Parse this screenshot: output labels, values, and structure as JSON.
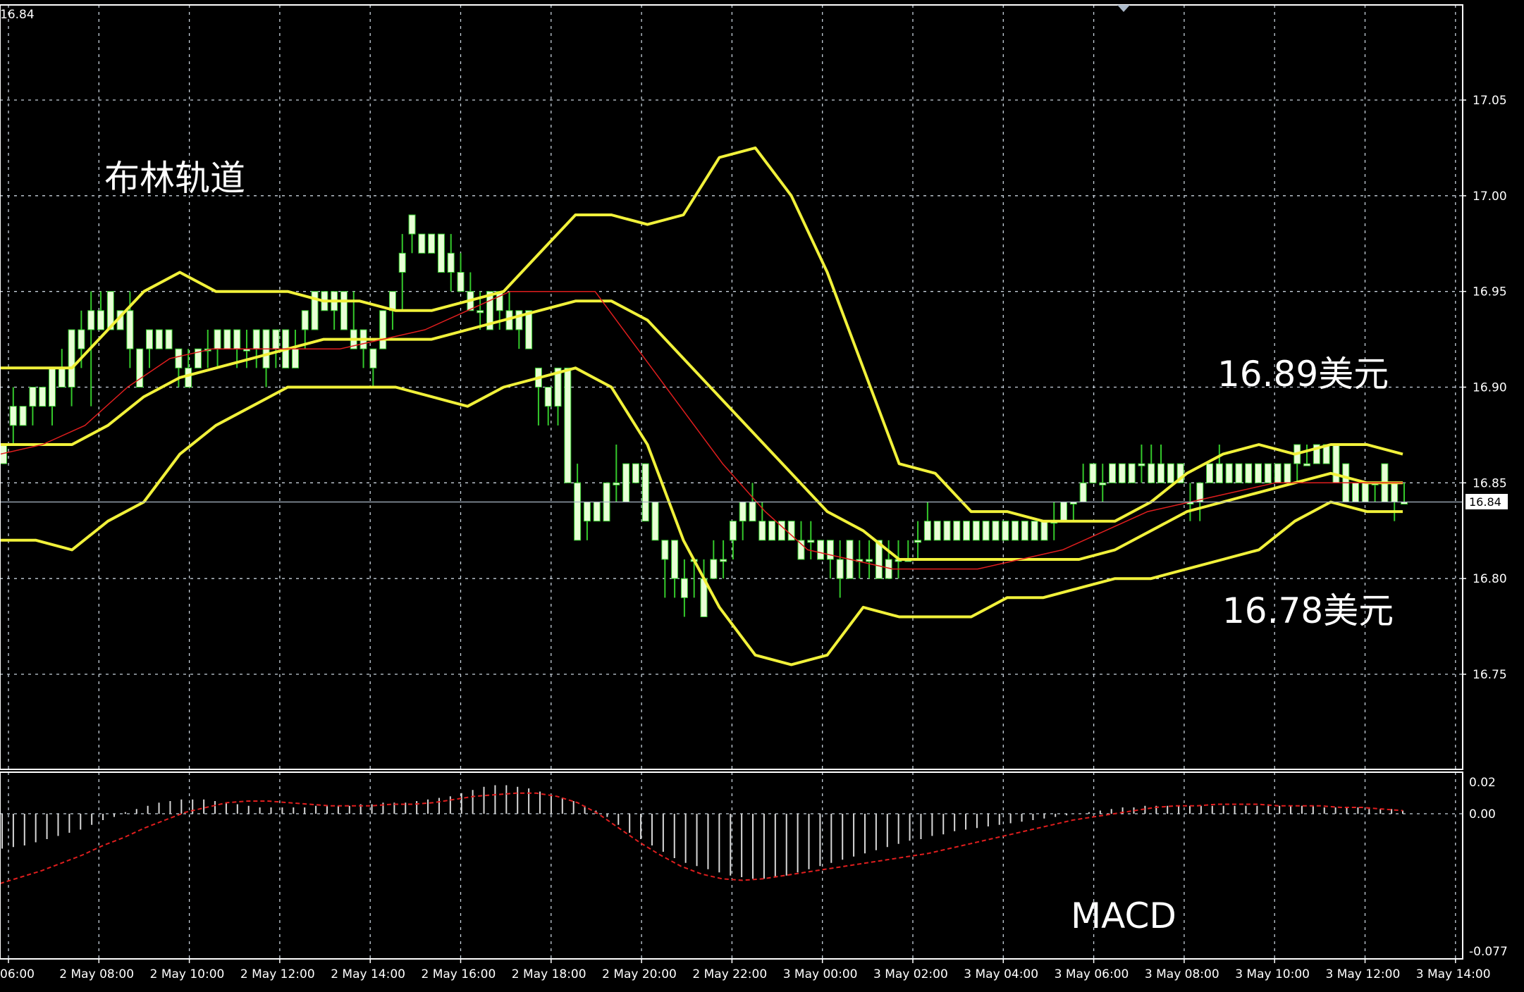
{
  "top_left_price": "16.84",
  "annotations": {
    "bollinger_title": "布林轨道",
    "upper_price": "16.89美元",
    "lower_price": "16.78美元",
    "macd_title": "MACD"
  },
  "current_price": {
    "label": "16.84",
    "value": 16.84
  },
  "colors": {
    "background": "#000000",
    "grid": "#c8d2dc",
    "bull_candle_fill": "#e8ffd6",
    "bull_candle_wick": "#34c92b",
    "bollinger": "#f1f13a",
    "moving_average": "#e01e1e",
    "macd_histogram": "#d8d8d8",
    "macd_signal": "#e01e1e",
    "axis_text": "#ffffff"
  },
  "chart_data": [
    {
      "type": "candlestick",
      "title": "布林轨道",
      "y_ticks": [
        "17.05",
        "17.00",
        "16.95",
        "16.90",
        "16.85",
        "16.80",
        "16.75"
      ],
      "ylim": [
        16.705,
        17.085
      ],
      "x_ticks": [
        "2 May 06:00",
        "2 May 08:00",
        "2 May 10:00",
        "2 May 12:00",
        "2 May 14:00",
        "2 May 16:00",
        "2 May 18:00",
        "2 May 20:00",
        "2 May 22:00",
        "3 May 00:00",
        "3 May 02:00",
        "3 May 04:00",
        "3 May 06:00",
        "3 May 08:00",
        "3 May 10:00",
        "3 May 12:00",
        "3 May 14:00"
      ],
      "grid": true,
      "candles_ohlc": [
        [
          16.86,
          16.87,
          16.86,
          16.87
        ],
        [
          16.89,
          16.9,
          16.87,
          16.88
        ],
        [
          16.88,
          16.89,
          16.88,
          16.89
        ],
        [
          16.89,
          16.9,
          16.88,
          16.9
        ],
        [
          16.9,
          16.9,
          16.89,
          16.89
        ],
        [
          16.89,
          16.91,
          16.88,
          16.91
        ],
        [
          16.91,
          16.92,
          16.9,
          16.9
        ],
        [
          16.9,
          16.93,
          16.89,
          16.93
        ],
        [
          16.93,
          16.94,
          16.91,
          16.92
        ],
        [
          16.93,
          16.95,
          16.89,
          16.94
        ],
        [
          16.93,
          16.95,
          16.93,
          16.94
        ],
        [
          16.95,
          16.95,
          16.94,
          16.93
        ],
        [
          16.94,
          16.94,
          16.93,
          16.93
        ],
        [
          16.94,
          16.95,
          16.91,
          16.92
        ],
        [
          16.92,
          16.92,
          16.9,
          16.9
        ],
        [
          16.93,
          16.93,
          16.91,
          16.92
        ],
        [
          16.92,
          16.93,
          16.92,
          16.93
        ],
        [
          16.92,
          16.93,
          16.92,
          16.93
        ],
        [
          16.92,
          16.92,
          16.9,
          16.91
        ],
        [
          16.91,
          16.92,
          16.9,
          16.9
        ],
        [
          16.91,
          16.92,
          16.91,
          16.92
        ],
        [
          16.92,
          16.93,
          16.91,
          16.92
        ],
        [
          16.92,
          16.93,
          16.91,
          16.93
        ],
        [
          16.93,
          16.93,
          16.92,
          16.92
        ],
        [
          16.92,
          16.93,
          16.91,
          16.93
        ],
        [
          16.92,
          16.93,
          16.91,
          16.92
        ],
        [
          16.92,
          16.93,
          16.91,
          16.93
        ],
        [
          16.91,
          16.93,
          16.9,
          16.93
        ],
        [
          16.93,
          16.93,
          16.91,
          16.92
        ],
        [
          16.93,
          16.93,
          16.91,
          16.91
        ],
        [
          16.92,
          16.93,
          16.91,
          16.91
        ],
        [
          16.93,
          16.94,
          16.92,
          16.94
        ],
        [
          16.93,
          16.95,
          16.93,
          16.95
        ],
        [
          16.95,
          16.95,
          16.94,
          16.94
        ],
        [
          16.95,
          16.95,
          16.93,
          16.94
        ],
        [
          16.95,
          16.95,
          16.93,
          16.93
        ],
        [
          16.93,
          16.95,
          16.92,
          16.92
        ],
        [
          16.93,
          16.93,
          16.91,
          16.92
        ],
        [
          16.92,
          16.92,
          16.9,
          16.91
        ],
        [
          16.92,
          16.94,
          16.92,
          16.94
        ],
        [
          16.94,
          16.95,
          16.93,
          16.95
        ],
        [
          16.96,
          16.98,
          16.94,
          16.97
        ],
        [
          16.99,
          16.99,
          16.97,
          16.98
        ],
        [
          16.98,
          16.98,
          16.97,
          16.97
        ],
        [
          16.98,
          16.98,
          16.97,
          16.97
        ],
        [
          16.98,
          16.98,
          16.96,
          16.96
        ],
        [
          16.96,
          16.98,
          16.95,
          16.97
        ],
        [
          16.96,
          16.97,
          16.95,
          16.95
        ],
        [
          16.95,
          16.96,
          16.94,
          16.94
        ],
        [
          16.94,
          16.95,
          16.93,
          16.94
        ],
        [
          16.95,
          16.95,
          16.93,
          16.93
        ],
        [
          16.95,
          16.95,
          16.93,
          16.94
        ],
        [
          16.94,
          16.95,
          16.93,
          16.93
        ],
        [
          16.94,
          16.94,
          16.92,
          16.93
        ],
        [
          16.94,
          16.94,
          16.92,
          16.92
        ],
        [
          16.91,
          16.91,
          16.88,
          16.9
        ],
        [
          16.89,
          16.9,
          16.88,
          16.9
        ],
        [
          16.89,
          16.91,
          16.88,
          16.91
        ],
        [
          16.91,
          16.91,
          16.85,
          16.85
        ],
        [
          16.85,
          16.86,
          16.82,
          16.82
        ],
        [
          16.84,
          16.84,
          16.82,
          16.83
        ],
        [
          16.83,
          16.84,
          16.83,
          16.84
        ],
        [
          16.83,
          16.85,
          16.83,
          16.85
        ],
        [
          16.85,
          16.87,
          16.84,
          16.85
        ],
        [
          16.86,
          16.86,
          16.84,
          16.84
        ],
        [
          16.86,
          16.86,
          16.85,
          16.85
        ],
        [
          16.86,
          16.86,
          16.83,
          16.83
        ],
        [
          16.84,
          16.84,
          16.82,
          16.82
        ],
        [
          16.82,
          16.82,
          16.79,
          16.81
        ],
        [
          16.82,
          16.82,
          16.79,
          16.8
        ],
        [
          16.79,
          16.81,
          16.78,
          16.8
        ],
        [
          16.81,
          16.81,
          16.79,
          16.81
        ],
        [
          16.78,
          16.81,
          16.78,
          16.8
        ],
        [
          16.8,
          16.82,
          16.8,
          16.81
        ],
        [
          16.81,
          16.82,
          16.8,
          16.81
        ],
        [
          16.82,
          16.83,
          16.81,
          16.83
        ],
        [
          16.83,
          16.84,
          16.82,
          16.84
        ],
        [
          16.84,
          16.85,
          16.83,
          16.83
        ],
        [
          16.83,
          16.84,
          16.82,
          16.82
        ],
        [
          16.83,
          16.83,
          16.82,
          16.82
        ],
        [
          16.83,
          16.83,
          16.82,
          16.82
        ],
        [
          16.82,
          16.83,
          16.82,
          16.83
        ],
        [
          16.82,
          16.83,
          16.81,
          16.81
        ],
        [
          16.82,
          16.83,
          16.81,
          16.82
        ],
        [
          16.82,
          16.82,
          16.81,
          16.81
        ],
        [
          16.82,
          16.82,
          16.8,
          16.81
        ],
        [
          16.81,
          16.82,
          16.79,
          16.8
        ],
        [
          16.82,
          16.82,
          16.8,
          16.8
        ],
        [
          16.81,
          16.82,
          16.8,
          16.81
        ],
        [
          16.81,
          16.82,
          16.8,
          16.81
        ],
        [
          16.82,
          16.82,
          16.8,
          16.8
        ],
        [
          16.81,
          16.82,
          16.8,
          16.8
        ],
        [
          16.81,
          16.82,
          16.8,
          16.81
        ],
        [
          16.81,
          16.82,
          16.81,
          16.81
        ],
        [
          16.82,
          16.83,
          16.81,
          16.82
        ],
        [
          16.83,
          16.84,
          16.82,
          16.82
        ],
        [
          16.83,
          16.83,
          16.82,
          16.82
        ],
        [
          16.83,
          16.83,
          16.82,
          16.82
        ],
        [
          16.83,
          16.83,
          16.82,
          16.82
        ],
        [
          16.83,
          16.83,
          16.82,
          16.82
        ],
        [
          16.83,
          16.83,
          16.82,
          16.82
        ],
        [
          16.83,
          16.83,
          16.82,
          16.82
        ],
        [
          16.83,
          16.83,
          16.82,
          16.82
        ],
        [
          16.83,
          16.83,
          16.82,
          16.82
        ],
        [
          16.83,
          16.83,
          16.82,
          16.82
        ],
        [
          16.83,
          16.83,
          16.82,
          16.82
        ],
        [
          16.83,
          16.83,
          16.82,
          16.82
        ],
        [
          16.83,
          16.83,
          16.82,
          16.82
        ],
        [
          16.83,
          16.84,
          16.82,
          16.83
        ],
        [
          16.83,
          16.84,
          16.83,
          16.84
        ],
        [
          16.84,
          16.84,
          16.83,
          16.84
        ],
        [
          16.84,
          16.86,
          16.84,
          16.85
        ],
        [
          16.85,
          16.86,
          16.85,
          16.86
        ],
        [
          16.85,
          16.86,
          16.84,
          16.85
        ],
        [
          16.85,
          16.86,
          16.85,
          16.86
        ],
        [
          16.85,
          16.86,
          16.85,
          16.86
        ],
        [
          16.85,
          16.86,
          16.85,
          16.86
        ],
        [
          16.86,
          16.87,
          16.85,
          16.86
        ],
        [
          16.86,
          16.87,
          16.85,
          16.85
        ],
        [
          16.86,
          16.87,
          16.85,
          16.85
        ],
        [
          16.86,
          16.86,
          16.85,
          16.85
        ],
        [
          16.85,
          16.86,
          16.85,
          16.86
        ],
        [
          16.84,
          16.85,
          16.83,
          16.84
        ],
        [
          16.84,
          16.85,
          16.83,
          16.85
        ],
        [
          16.86,
          16.86,
          16.85,
          16.85
        ],
        [
          16.86,
          16.87,
          16.85,
          16.85
        ],
        [
          16.86,
          16.86,
          16.85,
          16.85
        ],
        [
          16.86,
          16.86,
          16.85,
          16.85
        ],
        [
          16.86,
          16.86,
          16.85,
          16.85
        ],
        [
          16.86,
          16.86,
          16.85,
          16.85
        ],
        [
          16.86,
          16.86,
          16.85,
          16.85
        ],
        [
          16.86,
          16.86,
          16.85,
          16.85
        ],
        [
          16.85,
          16.86,
          16.85,
          16.86
        ],
        [
          16.86,
          16.87,
          16.85,
          16.87
        ],
        [
          16.86,
          16.87,
          16.86,
          16.86
        ],
        [
          16.87,
          16.87,
          16.86,
          16.86
        ],
        [
          16.86,
          16.87,
          16.86,
          16.87
        ],
        [
          16.87,
          16.87,
          16.85,
          16.85
        ],
        [
          16.86,
          16.86,
          16.84,
          16.84
        ],
        [
          16.85,
          16.85,
          16.84,
          16.84
        ],
        [
          16.85,
          16.85,
          16.84,
          16.84
        ],
        [
          16.85,
          16.85,
          16.84,
          16.85
        ],
        [
          16.86,
          16.86,
          16.84,
          16.84
        ],
        [
          16.85,
          16.85,
          16.83,
          16.84
        ],
        [
          16.84,
          16.85,
          16.84,
          16.84
        ]
      ],
      "bollinger_upper": [
        16.91,
        16.91,
        16.91,
        16.93,
        16.95,
        16.96,
        16.95,
        16.95,
        16.95,
        16.945,
        16.945,
        16.94,
        16.94,
        16.945,
        16.95,
        16.97,
        16.99,
        16.99,
        16.985,
        16.99,
        17.02,
        17.025,
        17.0,
        16.96,
        16.91,
        16.86,
        16.855,
        16.835,
        16.835,
        16.83,
        16.83,
        16.83,
        16.84,
        16.855,
        16.865,
        16.87,
        16.865,
        16.87,
        16.87,
        16.865
      ],
      "bollinger_middle": [
        16.87,
        16.87,
        16.87,
        16.88,
        16.895,
        16.905,
        16.91,
        16.915,
        16.92,
        16.925,
        16.925,
        16.925,
        16.925,
        16.93,
        16.935,
        16.94,
        16.945,
        16.945,
        16.935,
        16.915,
        16.895,
        16.875,
        16.855,
        16.835,
        16.825,
        16.81,
        16.81,
        16.81,
        16.81,
        16.81,
        16.81,
        16.815,
        16.825,
        16.835,
        16.84,
        16.845,
        16.85,
        16.855,
        16.85,
        16.85
      ],
      "bollinger_lower": [
        16.82,
        16.82,
        16.815,
        16.83,
        16.84,
        16.865,
        16.88,
        16.89,
        16.9,
        16.9,
        16.9,
        16.9,
        16.895,
        16.89,
        16.9,
        16.905,
        16.91,
        16.9,
        16.87,
        16.82,
        16.785,
        16.76,
        16.755,
        16.76,
        16.785,
        16.78,
        16.78,
        16.78,
        16.79,
        16.79,
        16.795,
        16.8,
        16.8,
        16.805,
        16.81,
        16.815,
        16.83,
        16.84,
        16.835,
        16.835
      ],
      "moving_average": [
        16.865,
        16.87,
        16.88,
        16.9,
        16.915,
        16.92,
        16.92,
        16.92,
        16.92,
        16.925,
        16.93,
        16.94,
        16.95,
        16.95,
        16.95,
        16.92,
        16.89,
        16.86,
        16.835,
        16.815,
        16.81,
        16.805,
        16.805,
        16.805,
        16.81,
        16.815,
        16.825,
        16.835,
        16.84,
        16.845,
        16.85,
        16.85,
        16.85,
        16.85
      ]
    },
    {
      "type": "bar",
      "title": "MACD",
      "y_ticks": [
        "0.02",
        "0.00",
        "-0.077"
      ],
      "ylim": [
        -0.077,
        0.02
      ],
      "grid": true,
      "histogram": [
        -0.022,
        -0.021,
        -0.02,
        -0.018,
        -0.016,
        -0.014,
        -0.012,
        -0.01,
        -0.007,
        -0.004,
        -0.002,
        0.001,
        0.003,
        0.005,
        0.007,
        0.008,
        0.009,
        0.009,
        0.009,
        0.008,
        0.007,
        0.006,
        0.005,
        0.004,
        0.004,
        0.004,
        0.004,
        0.004,
        0.005,
        0.005,
        0.005,
        0.005,
        0.006,
        0.006,
        0.007,
        0.007,
        0.007,
        0.008,
        0.009,
        0.01,
        0.011,
        0.013,
        0.015,
        0.017,
        0.018,
        0.018,
        0.017,
        0.016,
        0.014,
        0.012,
        0.01,
        0.008,
        0.005,
        0.002,
        -0.002,
        -0.007,
        -0.012,
        -0.016,
        -0.02,
        -0.024,
        -0.028,
        -0.031,
        -0.033,
        -0.035,
        -0.037,
        -0.039,
        -0.04,
        -0.041,
        -0.041,
        -0.04,
        -0.039,
        -0.037,
        -0.035,
        -0.033,
        -0.031,
        -0.029,
        -0.027,
        -0.025,
        -0.023,
        -0.021,
        -0.019,
        -0.017,
        -0.016,
        -0.014,
        -0.013,
        -0.011,
        -0.01,
        -0.009,
        -0.008,
        -0.007,
        -0.006,
        -0.005,
        -0.004,
        -0.003,
        -0.002,
        -0.001,
        0.0,
        0.001,
        0.002,
        0.003,
        0.004,
        0.004,
        0.005,
        0.005,
        0.005,
        0.005,
        0.005,
        0.005,
        0.005,
        0.005,
        0.005,
        0.005,
        0.005,
        0.005,
        0.005,
        0.005,
        0.005,
        0.005,
        0.004,
        0.004,
        0.004,
        0.004,
        0.003,
        0.003,
        0.003,
        0.002
      ],
      "signal": [
        -0.044,
        -0.04,
        -0.036,
        -0.031,
        -0.026,
        -0.02,
        -0.015,
        -0.009,
        -0.004,
        0.001,
        0.004,
        0.007,
        0.008,
        0.008,
        0.007,
        0.006,
        0.005,
        0.005,
        0.005,
        0.006,
        0.006,
        0.007,
        0.009,
        0.011,
        0.012,
        0.013,
        0.013,
        0.011,
        0.007,
        0.0,
        -0.009,
        -0.018,
        -0.026,
        -0.033,
        -0.038,
        -0.041,
        -0.042,
        -0.041,
        -0.039,
        -0.037,
        -0.035,
        -0.033,
        -0.031,
        -0.029,
        -0.027,
        -0.025,
        -0.022,
        -0.019,
        -0.016,
        -0.013,
        -0.01,
        -0.007,
        -0.004,
        -0.002,
        0.0,
        0.002,
        0.004,
        0.005,
        0.005,
        0.006,
        0.006,
        0.006,
        0.005,
        0.005,
        0.005,
        0.004,
        0.004,
        0.003,
        0.002
      ]
    }
  ]
}
